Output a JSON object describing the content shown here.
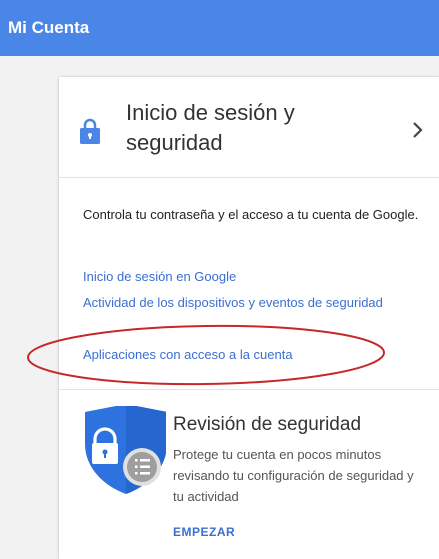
{
  "header": {
    "title": "Mi Cuenta"
  },
  "card": {
    "title": "Inicio de sesión y seguridad",
    "lock_icon": "lock-icon",
    "chevron_icon": "chevron-right-icon",
    "description": "Controla tu contraseña y el acceso a tu cuenta de Google.",
    "links": [
      "Inicio de sesión en Google",
      "Actividad de los dispositivos y eventos de seguridad",
      "Aplicaciones con acceso a la cuenta"
    ]
  },
  "security_review": {
    "icon": "shield-lock-icon",
    "title": "Revisión de seguridad",
    "description": "Protege tu cuenta en pocos minutos revisando tu configuración de seguridad y tu actividad",
    "button_label": "EMPEZAR"
  },
  "colors": {
    "header": "#4a86e8",
    "link": "#3b6fd1",
    "annotation": "#c62828"
  }
}
